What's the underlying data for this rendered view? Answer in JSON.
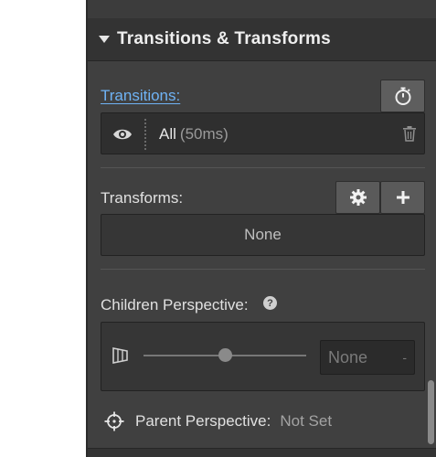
{
  "section": {
    "title": "Transitions & Transforms"
  },
  "transitions": {
    "label": "Transitions:",
    "item": {
      "name": "All",
      "duration": "(50ms)"
    }
  },
  "transforms": {
    "label": "Transforms:",
    "value": "None"
  },
  "children_perspective": {
    "label": "Children Perspective:",
    "help": "?",
    "slider_level": 0.5,
    "input_value": "None",
    "unit": "-"
  },
  "parent_perspective": {
    "label": "Parent Perspective:",
    "value": "Not Set"
  },
  "icons": [
    "caret-down-icon",
    "stopwatch-icon",
    "eye-icon",
    "trash-icon",
    "gear-icon",
    "plus-icon",
    "perspective-icon",
    "crosshair-icon"
  ]
}
